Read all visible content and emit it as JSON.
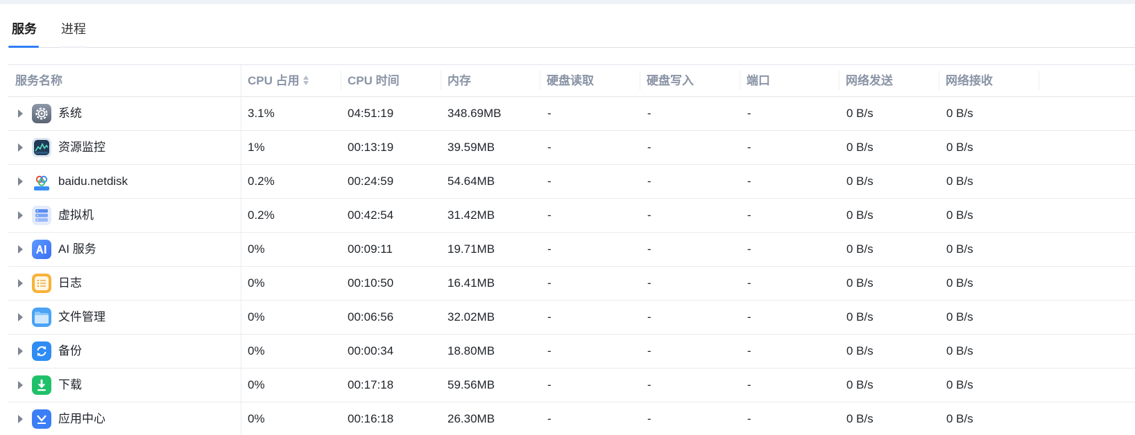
{
  "tabs": [
    {
      "label": "服务",
      "active": true
    },
    {
      "label": "进程",
      "active": false
    }
  ],
  "columns": {
    "name": "服务名称",
    "cpu": "CPU 占用",
    "cpu_time": "CPU 时间",
    "memory": "内存",
    "disk_read": "硬盘读取",
    "disk_write": "硬盘写入",
    "port": "端口",
    "net_send": "网络发送",
    "net_recv": "网络接收"
  },
  "rows": [
    {
      "icon": "gear-icon",
      "name": "系统",
      "cpu": "3.1%",
      "cpu_time": "04:51:19",
      "memory": "348.69MB",
      "disk_read": "-",
      "disk_write": "-",
      "port": "-",
      "net_send": "0 B/s",
      "net_recv": "0 B/s"
    },
    {
      "icon": "resource-monitor-icon",
      "name": "资源监控",
      "cpu": "1%",
      "cpu_time": "00:13:19",
      "memory": "39.59MB",
      "disk_read": "-",
      "disk_write": "-",
      "port": "-",
      "net_send": "0 B/s",
      "net_recv": "0 B/s"
    },
    {
      "icon": "baidu-netdisk-icon",
      "name": "baidu.netdisk",
      "cpu": "0.2%",
      "cpu_time": "00:24:59",
      "memory": "54.64MB",
      "disk_read": "-",
      "disk_write": "-",
      "port": "-",
      "net_send": "0 B/s",
      "net_recv": "0 B/s"
    },
    {
      "icon": "virtual-machine-icon",
      "name": "虚拟机",
      "cpu": "0.2%",
      "cpu_time": "00:42:54",
      "memory": "31.42MB",
      "disk_read": "-",
      "disk_write": "-",
      "port": "-",
      "net_send": "0 B/s",
      "net_recv": "0 B/s"
    },
    {
      "icon": "ai-icon",
      "name": "AI 服务",
      "cpu": "0%",
      "cpu_time": "00:09:11",
      "memory": "19.71MB",
      "disk_read": "-",
      "disk_write": "-",
      "port": "-",
      "net_send": "0 B/s",
      "net_recv": "0 B/s"
    },
    {
      "icon": "log-icon",
      "name": "日志",
      "cpu": "0%",
      "cpu_time": "00:10:50",
      "memory": "16.41MB",
      "disk_read": "-",
      "disk_write": "-",
      "port": "-",
      "net_send": "0 B/s",
      "net_recv": "0 B/s"
    },
    {
      "icon": "folder-icon",
      "name": "文件管理",
      "cpu": "0%",
      "cpu_time": "00:06:56",
      "memory": "32.02MB",
      "disk_read": "-",
      "disk_write": "-",
      "port": "-",
      "net_send": "0 B/s",
      "net_recv": "0 B/s"
    },
    {
      "icon": "backup-icon",
      "name": "备份",
      "cpu": "0%",
      "cpu_time": "00:00:34",
      "memory": "18.80MB",
      "disk_read": "-",
      "disk_write": "-",
      "port": "-",
      "net_send": "0 B/s",
      "net_recv": "0 B/s"
    },
    {
      "icon": "download-icon",
      "name": "下载",
      "cpu": "0%",
      "cpu_time": "00:17:18",
      "memory": "59.56MB",
      "disk_read": "-",
      "disk_write": "-",
      "port": "-",
      "net_send": "0 B/s",
      "net_recv": "0 B/s"
    },
    {
      "icon": "app-center-icon",
      "name": "应用中心",
      "cpu": "0%",
      "cpu_time": "00:16:18",
      "memory": "26.30MB",
      "disk_read": "-",
      "disk_write": "-",
      "port": "-",
      "net_send": "0 B/s",
      "net_recv": "0 B/s"
    }
  ],
  "colors": {
    "accent": "#2f7df6",
    "header_text": "#8a94a6",
    "border": "#e8ebef"
  }
}
